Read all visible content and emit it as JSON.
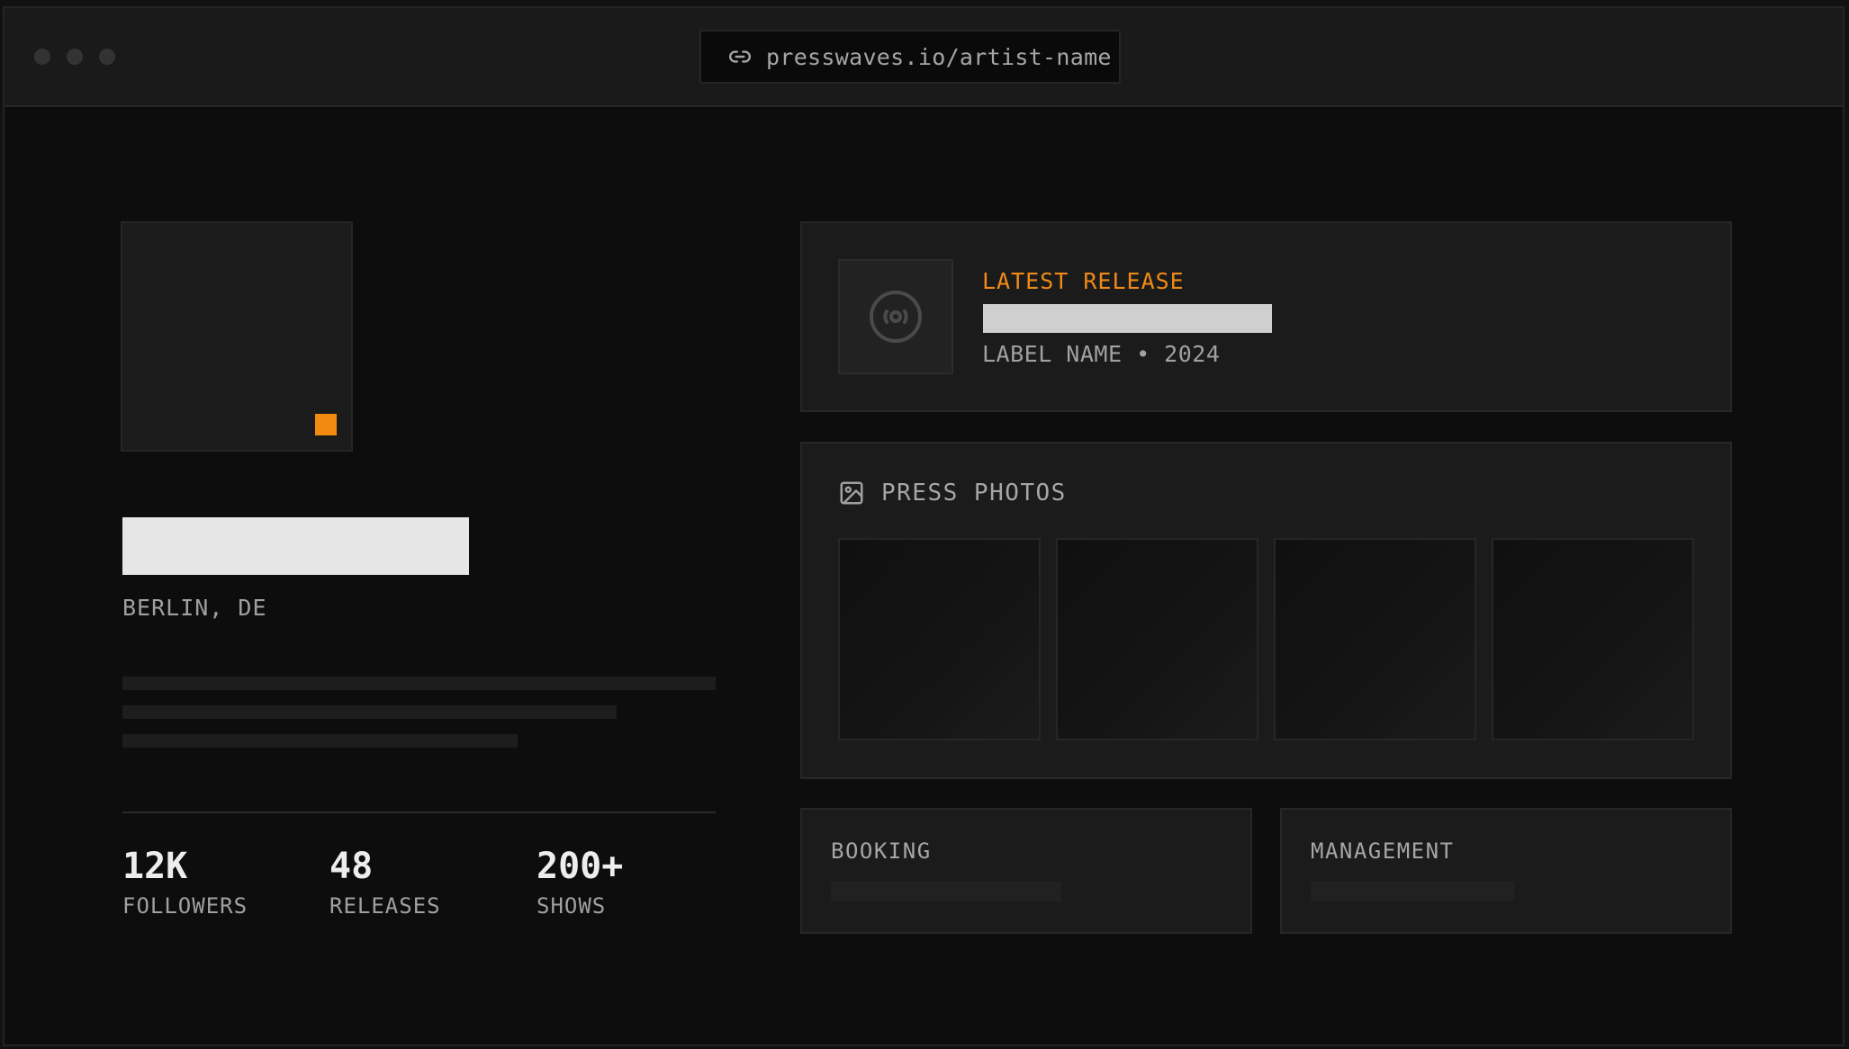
{
  "browser": {
    "url": "presswaves.io/artist-name",
    "url_icon": "link-icon"
  },
  "artist": {
    "location": "BERLIN, DE",
    "accent_color": "#f28a12"
  },
  "stats": [
    {
      "value": "12K",
      "label": "FOLLOWERS"
    },
    {
      "value": "48",
      "label": "RELEASES"
    },
    {
      "value": "200+",
      "label": "SHOWS"
    }
  ],
  "latest_release": {
    "eyebrow": "LATEST RELEASE",
    "meta": "LABEL NAME • 2024",
    "icon": "vinyl-disc-icon"
  },
  "press_photos": {
    "title": "PRESS PHOTOS",
    "icon": "image-icon"
  },
  "contacts": {
    "booking_label": "BOOKING",
    "management_label": "MANAGEMENT"
  }
}
